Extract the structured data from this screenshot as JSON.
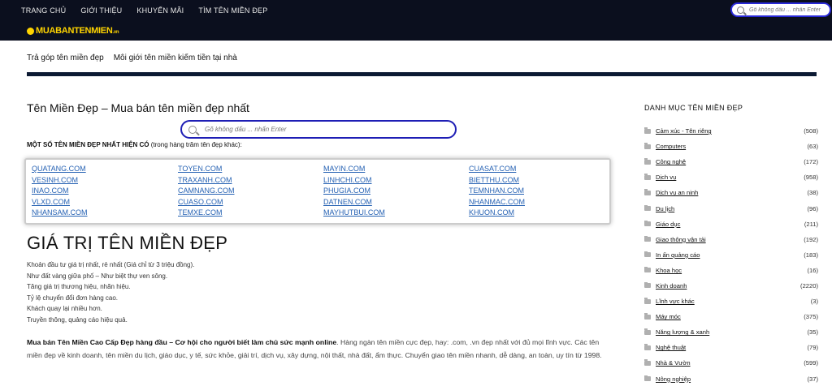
{
  "header": {
    "nav": [
      "TRANG CHỦ",
      "GIỚI THIỆU",
      "KHUYẾN MÃI",
      "TÌM TÊN MIỀN ĐẸP"
    ],
    "search_placeholder": "Gõ không dấu ... nhấn Enter",
    "logo": "MUABANTENMIEN",
    "logo_suffix": ".vn"
  },
  "subnav": [
    "Trả góp tên miền đẹp",
    "Môi giới tên miền kiếm tiền tại nhà"
  ],
  "main": {
    "title": "Tên Miền Đẹp – Mua bán tên miền đẹp nhất",
    "search_placeholder": "Gõ không dấu ... nhấn Enter",
    "intro_bold": "MỘT SỐ TÊN MIỀN ĐẸP NHẤT HIỆN CÓ",
    "intro_rest": " (trong hàng trăm tên đẹp khác):",
    "domains": [
      "QUATANG.COM",
      "TOYEN.COM",
      "MAYIN.COM",
      "CUASAT.COM",
      "VESINH.COM",
      "TRAXANH.COM",
      "LINHCHI.COM",
      "BIETTHU.COM",
      "INAO.COM",
      "CAMNANG.COM",
      "PHUGIA.COM",
      "TEMNHAN.COM",
      "VLXD.COM",
      "CUASO.COM",
      "DATNEN.COM",
      "NHANMAC.COM",
      "NHANSAM.COM",
      "TEMXE.COM",
      "MAYHUTBUI.COM",
      "KHUON.COM"
    ],
    "heading": "GIÁ TRỊ TÊN MIỀN ĐẸP",
    "value_lines": [
      "Khoản đầu tư giá trị nhất, rẻ nhất (Giá chỉ từ 3 triệu đồng).",
      "Như đất vàng giữa phố – Như biệt thự ven sông.",
      "Tăng giá trị thương hiệu, nhãn hiệu.",
      "Tỷ lệ chuyển đổi đơn hàng cao.",
      "Khách quay lại nhiều hơn.",
      "Truyền thông, quảng cáo hiệu quả."
    ],
    "para_bold": "Mua bán Tên Miền Cao Cấp Đẹp hàng đầu – Cơ hội cho người biết làm chủ sức mạnh online",
    "para_text": ". Hàng ngàn tên miền cực đẹp, hay: .com, .vn đẹp nhất với đủ mọi lĩnh vực. Các tên miền đẹp về kinh doanh, tên miền du lịch, giáo dục, y tế, sức khỏe, giải trí, dịch vụ, xây dựng, nội thất, nhà đất, ẩm thực. Chuyển giao tên miền nhanh, dễ dàng, an toàn, uy tín từ 1998."
  },
  "sidebar": {
    "title": "DANH MỤC TÊN MIỀN ĐẸP",
    "categories": [
      {
        "name": "Cảm xúc - Tên riêng",
        "count": "(508)"
      },
      {
        "name": "Computers",
        "count": "(63)"
      },
      {
        "name": "Công nghệ",
        "count": "(172)"
      },
      {
        "name": "Dịch vụ",
        "count": "(958)"
      },
      {
        "name": "Dịch vụ an ninh",
        "count": "(38)"
      },
      {
        "name": "Du lịch",
        "count": "(96)"
      },
      {
        "name": "Giáo dục",
        "count": "(211)"
      },
      {
        "name": "Giao thông vận tải",
        "count": "(192)"
      },
      {
        "name": "In ấn quảng cáo",
        "count": "(183)"
      },
      {
        "name": "Khoa học",
        "count": "(16)"
      },
      {
        "name": "Kinh doanh",
        "count": "(2220)"
      },
      {
        "name": "Lĩnh vực khác",
        "count": "(3)"
      },
      {
        "name": "Máy móc",
        "count": "(375)"
      },
      {
        "name": "Năng lượng & xanh",
        "count": "(35)"
      },
      {
        "name": "Nghệ thuật",
        "count": "(79)"
      },
      {
        "name": "Nhà & Vườn",
        "count": "(599)"
      },
      {
        "name": "Nông nghiệp",
        "count": "(37)"
      }
    ]
  },
  "colors": {
    "header_bg": "#0b0f1e",
    "logo": "#ffd400",
    "search_border": "#1e1eb5",
    "link": "#2561b3"
  },
  "icons": {
    "search": "search-icon",
    "folder": "folder-icon"
  }
}
